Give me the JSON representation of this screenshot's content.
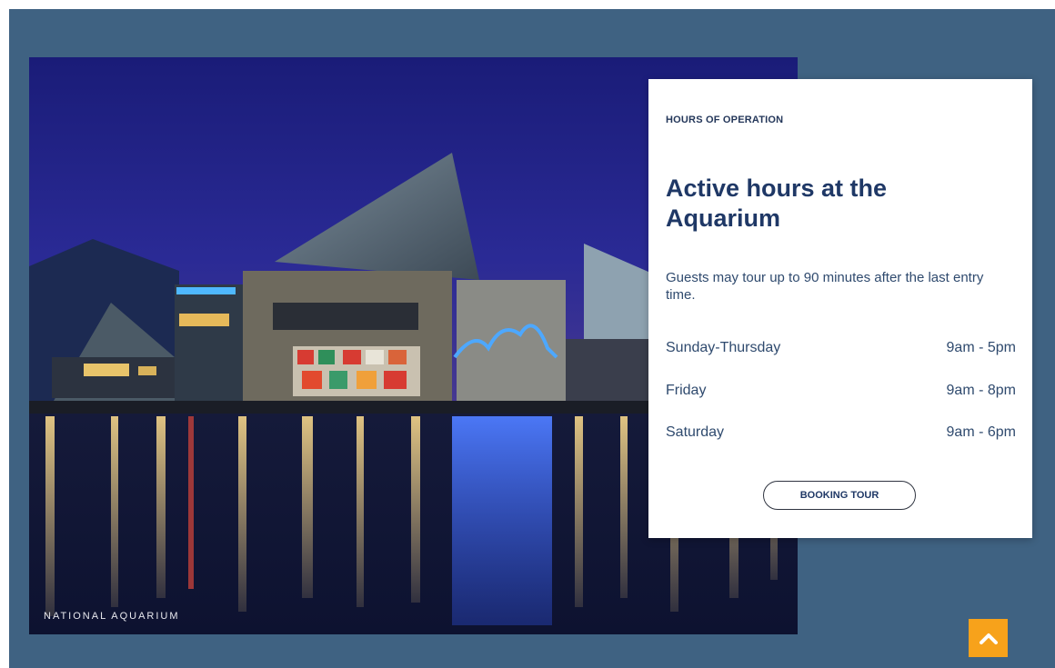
{
  "photo": {
    "caption": "NATIONAL AQUARIUM"
  },
  "hours_card": {
    "eyebrow": "HOURS OF OPERATION",
    "title": "Active hours at the Aquarium",
    "note": "Guests may tour up to 90 minutes after the last entry time.",
    "schedule": [
      {
        "days": "Sunday-Thursday",
        "time": "9am - 5pm"
      },
      {
        "days": "Friday",
        "time": "9am - 8pm"
      },
      {
        "days": "Saturday",
        "time": "9am - 6pm"
      }
    ],
    "button_label": "BOOKING TOUR"
  },
  "scroll_top": {
    "icon": "chevron-up-icon"
  },
  "colors": {
    "page_background": "#3f6282",
    "card_background": "#ffffff",
    "title_text": "#1f3866",
    "scroll_top_button": "#f7a21b"
  }
}
